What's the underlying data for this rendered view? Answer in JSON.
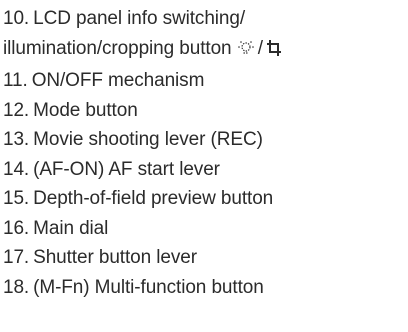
{
  "items": [
    {
      "number": "10.",
      "text": "LCD panel info switching/",
      "text2": "illumination/cropping button",
      "icons": [
        "illumination-icon",
        "crop-icon"
      ],
      "icon_separator": "/"
    },
    {
      "number": "11.",
      "text": "ON/OFF mechanism"
    },
    {
      "number": "12.",
      "text": "Mode button"
    },
    {
      "number": "13.",
      "text": "Movie shooting lever (REC)"
    },
    {
      "number": "14.",
      "text": "(AF-ON) AF start lever"
    },
    {
      "number": "15.",
      "text": "Depth-of-field preview button"
    },
    {
      "number": "16.",
      "text": "Main dial"
    },
    {
      "number": "17.",
      "text": "Shutter button lever"
    },
    {
      "number": "18.",
      "text": "(M-Fn) Multi-function button"
    }
  ]
}
